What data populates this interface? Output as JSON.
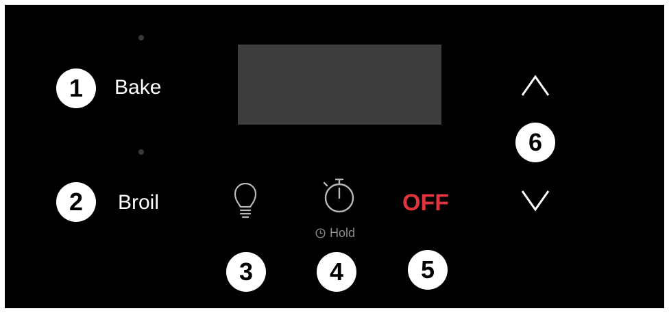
{
  "panel": {
    "buttons": [
      {
        "number": "1",
        "label": "Bake"
      },
      {
        "number": "2",
        "label": "Broil"
      },
      {
        "number": "3"
      },
      {
        "number": "4",
        "sub_label": "Hold"
      },
      {
        "number": "5",
        "label": "OFF"
      },
      {
        "number": "6"
      }
    ]
  },
  "icons": {
    "light": "lightbulb-icon",
    "timer": "stopwatch-icon",
    "hold": "clock-icon",
    "up": "chevron-up-icon",
    "down": "chevron-down-icon"
  },
  "colors": {
    "background": "#000000",
    "display": "#3d3d3d",
    "off": "#e0353e",
    "icon_gray": "#b9b9b9",
    "badge": "#ffffff"
  }
}
